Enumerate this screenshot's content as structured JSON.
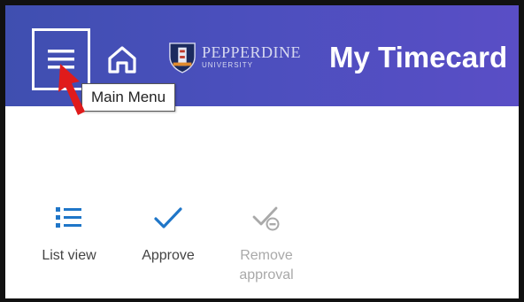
{
  "header": {
    "menu_tooltip": "Main Menu",
    "logo": {
      "name": "PEPPERDINE",
      "sub": "UNIVERSITY"
    },
    "title": "My Timecard"
  },
  "toolbar": {
    "items": [
      {
        "label": "List view",
        "icon": "list-icon",
        "enabled": true
      },
      {
        "label": "Approve",
        "icon": "checkmark-icon",
        "enabled": true
      },
      {
        "label": "Remove approval",
        "icon": "remove-approval-icon",
        "enabled": false
      }
    ]
  },
  "colors": {
    "header_bg": "#4b4fbd",
    "icon_accent": "#1f76c8",
    "disabled": "#a9a9a9",
    "annotation_arrow": "#e01b1b"
  }
}
